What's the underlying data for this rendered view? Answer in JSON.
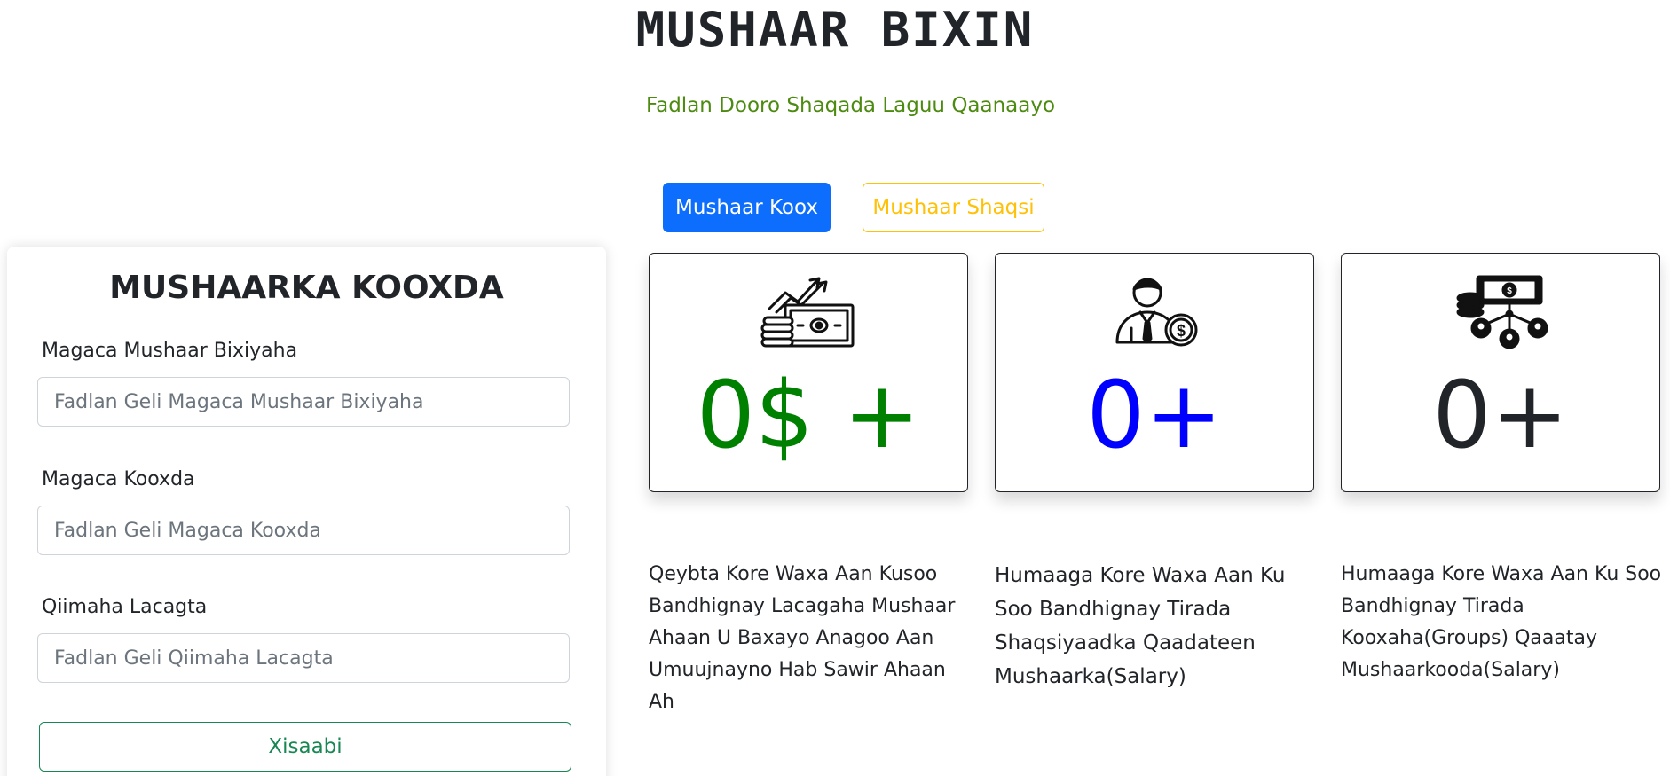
{
  "page": {
    "title": "MUSHAAR BIXIN",
    "subtitle": "Fadlan Dooro Shaqada Laguu Qaanaayo"
  },
  "tabs": {
    "group_label": "Mushaar Koox",
    "individual_label": "Mushaar Shaqsi"
  },
  "form": {
    "title": "MUSHAARKA KOOXDA",
    "payer_label": "Magaca Mushaar Bixiyaha",
    "payer_placeholder": "Fadlan Geli Magaca Mushaar Bixiyaha",
    "group_label": "Magaca Kooxda",
    "group_placeholder": "Fadlan Geli Magaca Kooxda",
    "amount_label": "Qiimaha Lacagta",
    "amount_placeholder": "Fadlan Geli Qiimaha Lacagta",
    "submit_label": "Xisaabi"
  },
  "stats": [
    {
      "icon": "money-growth-icon",
      "value": "0$ +",
      "color": "#008000",
      "description": "Qeybta Kore Waxa Aan Kusoo Bandhignay Lacagaha Mushaar Ahaan U Baxayo Anagoo Aan Umuujnayno Hab Sawir Ahaan Ah"
    },
    {
      "icon": "employee-salary-icon",
      "value": "0+",
      "color": "#0000ff",
      "description": "Humaaga Kore Waxa Aan Ku Soo Bandhignay Tirada Shaqsiyaadka Qaadateen Mushaarka(Salary)"
    },
    {
      "icon": "group-payment-icon",
      "value": "0+",
      "color": "#212529",
      "description": "Humaaga Kore Waxa Aan Ku Soo Bandhignay Tirada Kooxaha(Groups) Qaaatay Mushaarkooda(Salary)"
    }
  ]
}
